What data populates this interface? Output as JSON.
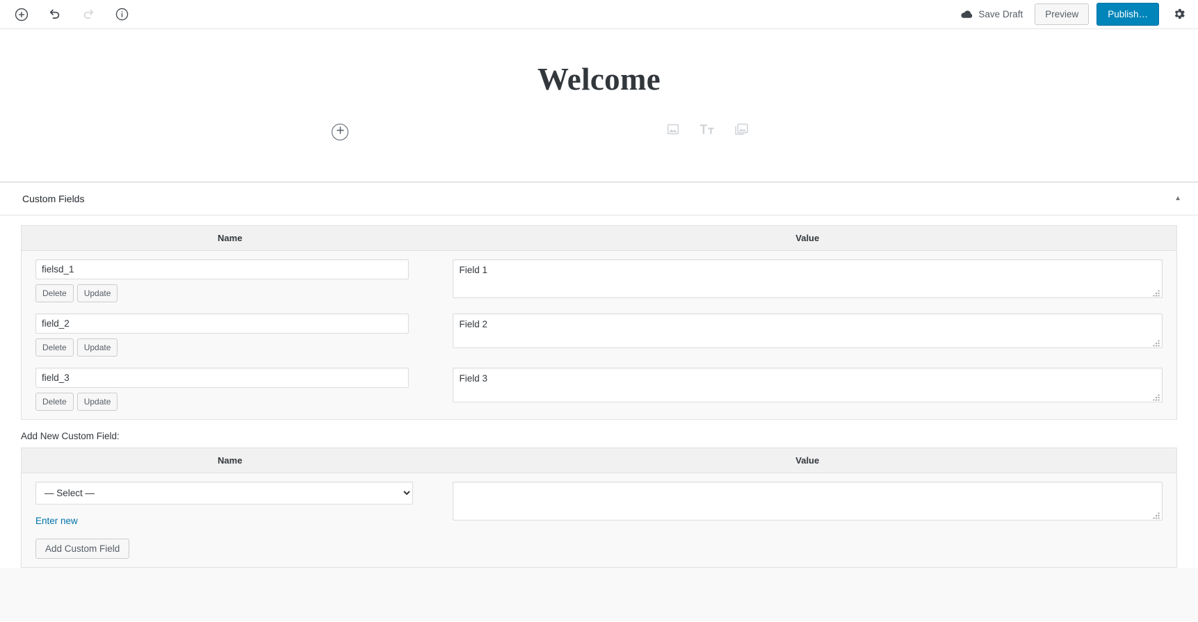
{
  "toolbar": {
    "add_block_icon": "plus-circle-icon",
    "undo_icon": "undo-icon",
    "redo_icon": "redo-icon",
    "info_icon": "info-icon",
    "save_draft_label": "Save Draft",
    "save_draft_icon": "cloud-icon",
    "preview_label": "Preview",
    "publish_label": "Publish…",
    "settings_icon": "gear-icon",
    "publish_color": "#0085ba"
  },
  "canvas": {
    "post_title": "Welcome",
    "inserter_icon": "plus-circle-icon",
    "quick_inserts": [
      {
        "icon": "image-icon"
      },
      {
        "icon": "paragraph-icon",
        "glyph": "Tᴛ"
      },
      {
        "icon": "gallery-icon"
      }
    ]
  },
  "metabox": {
    "title": "Custom Fields",
    "toggle_icon": "chevron-up-icon",
    "columns": {
      "name": "Name",
      "value": "Value"
    },
    "rows": [
      {
        "name": "fielsd_1",
        "value": "Field 1",
        "delete_label": "Delete",
        "update_label": "Update"
      },
      {
        "name": "field_2",
        "value": "Field 2",
        "delete_label": "Delete",
        "update_label": "Update"
      },
      {
        "name": "field_3",
        "value": "Field 3",
        "delete_label": "Delete",
        "update_label": "Update"
      }
    ],
    "add_new": {
      "label": "Add New Custom Field:",
      "columns": {
        "name": "Name",
        "value": "Value"
      },
      "select_value": "— Select —",
      "select_options": [
        "— Select —"
      ],
      "value_text": "",
      "enter_new_label": "Enter new",
      "add_button_label": "Add Custom Field",
      "link_color": "#0073aa"
    }
  }
}
